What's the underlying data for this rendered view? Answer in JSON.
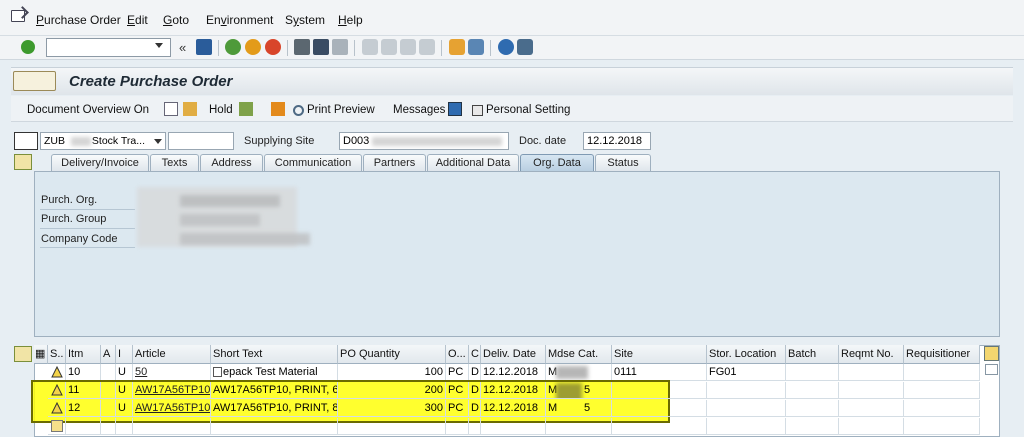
{
  "menu": {
    "items": [
      "Purchase Order",
      "Edit",
      "Goto",
      "Environment",
      "System",
      "Help"
    ],
    "mnemonics": [
      "P",
      "E",
      "G",
      "v",
      "y",
      "H"
    ]
  },
  "page": {
    "title": "Create Purchase Order"
  },
  "app_toolbar": {
    "doc_overview": "Document Overview On",
    "hold": "Hold",
    "print_preview": "Print Preview",
    "messages": "Messages",
    "personal_setting": "Personal Setting"
  },
  "header": {
    "doc_type_prefix": "ZUB",
    "doc_type_suffix": "Stock Tra...",
    "supplying_site_label": "Supplying Site",
    "supplying_site_value": "D003",
    "doc_date_label": "Doc. date",
    "doc_date_value": "12.12.2018"
  },
  "tabs": [
    {
      "label": "Delivery/Invoice",
      "active": false
    },
    {
      "label": "Texts",
      "active": false
    },
    {
      "label": "Address",
      "active": false
    },
    {
      "label": "Communication",
      "active": false
    },
    {
      "label": "Partners",
      "active": false
    },
    {
      "label": "Additional Data",
      "active": false
    },
    {
      "label": "Org. Data",
      "active": true
    },
    {
      "label": "Status",
      "active": false
    }
  ],
  "org_data": {
    "purch_org_label": "Purch. Org.",
    "purch_group_label": "Purch. Group",
    "company_code_label": "Company Code"
  },
  "grid": {
    "columns": [
      "S..",
      "Itm",
      "A",
      "I",
      "Article",
      "Short Text",
      "PO Quantity",
      "O...",
      "C",
      "Deliv. Date",
      "Mdse Cat.",
      "Site",
      "Stor. Location",
      "Batch",
      "Reqmt No.",
      "Requisitioner"
    ],
    "rows": [
      {
        "itm": "10",
        "i": "U",
        "article": "50",
        "short_text": "epack Test Material",
        "qty": "100",
        "unit": "PC",
        "c": "D",
        "date": "12.12.2018",
        "mdse": "M",
        "site": "0111",
        "stor": "FG01"
      },
      {
        "itm": "11",
        "i": "U",
        "article": "AW17A56TP10",
        "short_text": "AW17A56TP10, PRINT, 6",
        "qty": "200",
        "unit": "PC",
        "c": "D",
        "date": "12.12.2018",
        "mdse": "M",
        "mdse_end": "5",
        "site": "",
        "stor": ""
      },
      {
        "itm": "12",
        "i": "U",
        "article": "AW17A56TP10",
        "short_text": "AW17A56TP10, PRINT, 8",
        "qty": "300",
        "unit": "PC",
        "c": "D",
        "date": "12.12.2018",
        "mdse": "M",
        "mdse_end": "5",
        "site": "",
        "stor": ""
      }
    ]
  },
  "colors": {
    "highlight": "#ffff00",
    "title": "#1e2a35",
    "panel": "#dce8f0"
  }
}
